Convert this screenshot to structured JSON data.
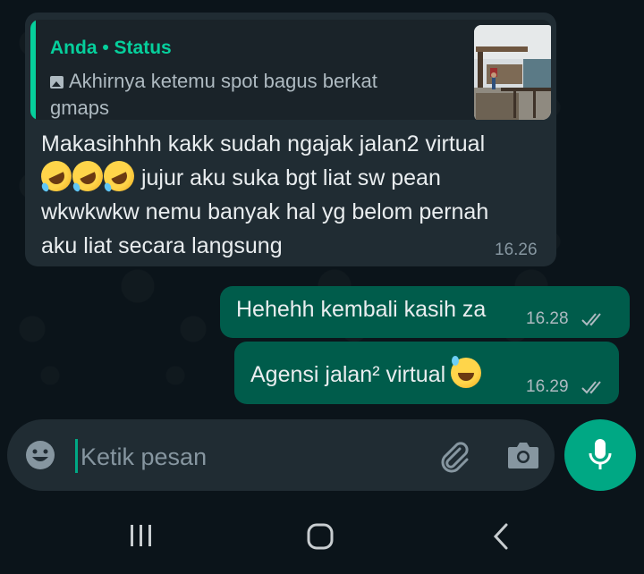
{
  "colors": {
    "background": "#0b141a",
    "incoming_bubble": "#202c33",
    "outgoing_bubble": "#005c4b",
    "accent": "#06cf9c",
    "mic_button": "#00a884",
    "secondary_text": "#8696a0"
  },
  "incoming": {
    "quote": {
      "author": "Anda • Status",
      "icon": "photo-icon",
      "text": "Akhirnya ketemu spot bagus berkat gmaps"
    },
    "text_line1": "Makasihhhh kakk sudah ngajak jalan2 virtual",
    "emojis": [
      "rolling-on-floor-laughing",
      "rolling-on-floor-laughing",
      "rolling-on-floor-laughing"
    ],
    "text_line2_rest": " jujur aku suka bgt liat sw pean",
    "text_line3": "wkwkwkw nemu banyak hal yg belom pernah",
    "text_line4": "aku liat secara langsung",
    "time": "16.26"
  },
  "outgoing": [
    {
      "text": "Hehehh kembali kasih za",
      "time": "16.28",
      "status": "read"
    },
    {
      "text": "Agensi jalan² virtual",
      "emoji": "grinning-face-with-sweat",
      "time": "16.29",
      "status": "read"
    }
  ],
  "composer": {
    "placeholder": "Ketik pesan",
    "emoji_icon": "emoji-icon",
    "attach_icon": "paperclip-icon",
    "camera_icon": "camera-icon",
    "mic_icon": "microphone-icon"
  },
  "navbar": {
    "recents_icon": "recent-apps-icon",
    "home_icon": "home-icon",
    "back_icon": "back-icon"
  }
}
